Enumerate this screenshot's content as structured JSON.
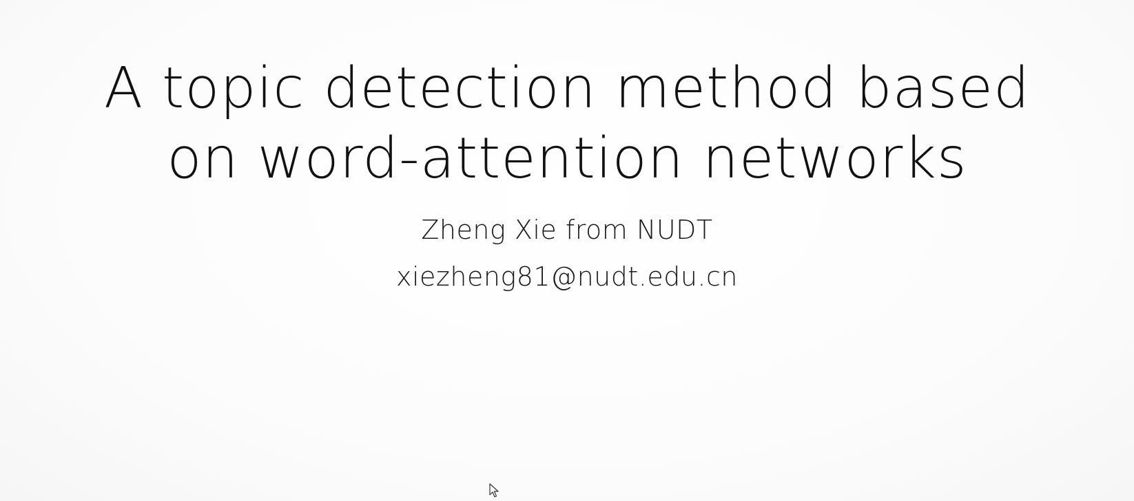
{
  "slide": {
    "title_lines": [
      "A topic detection method based",
      "on word-attention networks"
    ],
    "author": "Zheng Xie from NUDT",
    "email": "xiezheng81@nudt.edu.cn"
  },
  "cursor": {
    "icon": "mouse-pointer-icon"
  }
}
